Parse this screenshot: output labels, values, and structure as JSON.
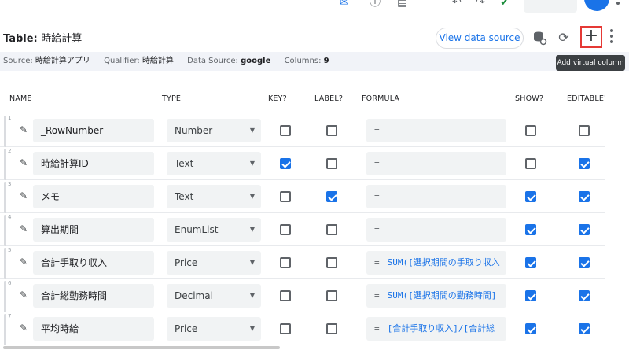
{
  "toolbar_top": {
    "icons": [
      "gmail-icon",
      "info-icon",
      "book-icon",
      "bell-off-icon",
      "undo-icon",
      "redo-icon",
      "check-icon"
    ]
  },
  "header": {
    "title_prefix": "Table:",
    "title_value": "時給計算",
    "view_data_source": "View data source",
    "add_label": "+",
    "tooltip": "Add virtual column"
  },
  "infobar": {
    "source_label": "Source:",
    "source_value": "時給計算アプリ",
    "qualifier_label": "Qualifier:",
    "qualifier_value": "時給計算",
    "datasource_label": "Data Source:",
    "datasource_value": "google",
    "columns_label": "Columns:",
    "columns_value": "9"
  },
  "columns": {
    "name": "NAME",
    "type": "TYPE",
    "key": "KEY?",
    "label": "LABEL?",
    "formula": "FORMULA",
    "show": "SHOW?",
    "editable": "EDITABLE?"
  },
  "rows": [
    {
      "num": "1",
      "name": "_RowNumber",
      "type": "Number",
      "key": false,
      "label": false,
      "formula": "",
      "show": false,
      "editable": false
    },
    {
      "num": "2",
      "name": "時給計算ID",
      "type": "Text",
      "key": true,
      "label": false,
      "formula": "",
      "show": false,
      "editable": true
    },
    {
      "num": "3",
      "name": "メモ",
      "type": "Text",
      "key": false,
      "label": true,
      "formula": "",
      "show": true,
      "editable": true
    },
    {
      "num": "4",
      "name": "算出期間",
      "type": "EnumList",
      "key": false,
      "label": false,
      "formula": "",
      "show": true,
      "editable": true
    },
    {
      "num": "5",
      "name": "合計手取り収入",
      "type": "Price",
      "key": false,
      "label": false,
      "formula": "SUM([選択期間の手取り収入",
      "show": true,
      "editable": true
    },
    {
      "num": "6",
      "name": "合計総勤務時間",
      "type": "Decimal",
      "key": false,
      "label": false,
      "formula": "SUM([選択期間の勤務時間]",
      "show": true,
      "editable": true
    },
    {
      "num": "7",
      "name": "平均時給",
      "type": "Price",
      "key": false,
      "label": false,
      "formula": "[合計手取り収入]/[合計総",
      "show": true,
      "editable": true
    }
  ],
  "formula_eq": "=",
  "colors": {
    "accent": "#1a73e8",
    "highlight": "#e53935"
  }
}
